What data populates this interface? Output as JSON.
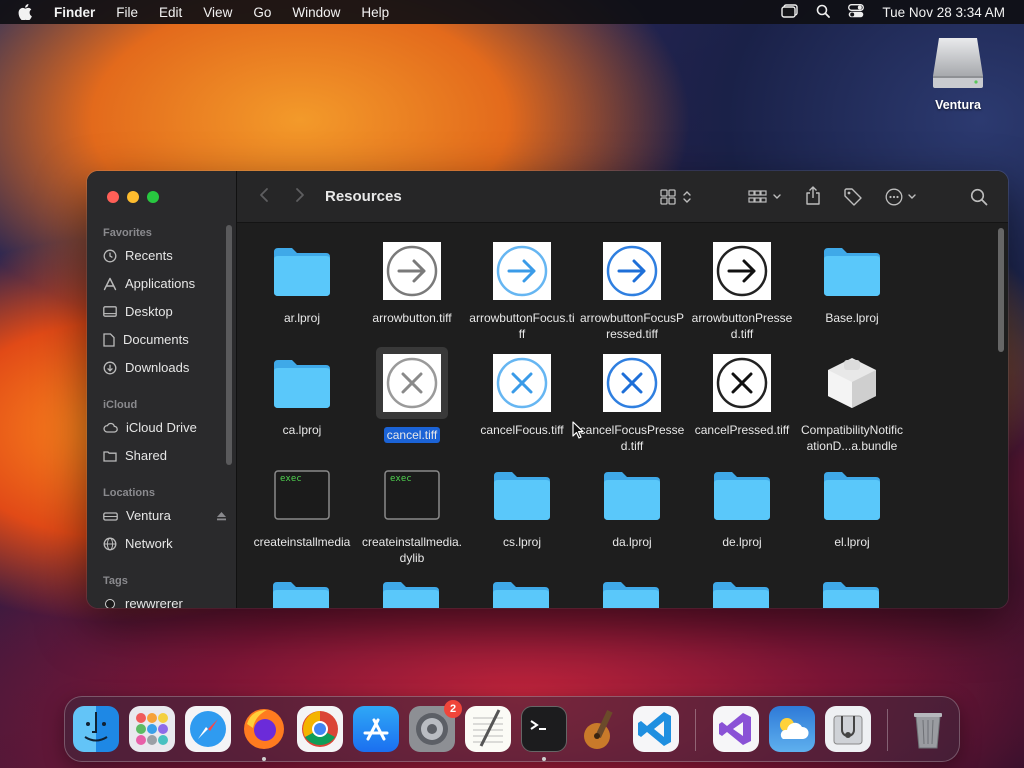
{
  "menubar": {
    "app": "Finder",
    "items": [
      "File",
      "Edit",
      "View",
      "Go",
      "Window",
      "Help"
    ],
    "clock": "Tue Nov 28  3:34 AM"
  },
  "desktop": {
    "drive_label": "Ventura"
  },
  "window": {
    "title": "Resources",
    "sidebar": {
      "favorites_header": "Favorites",
      "favorites": [
        "Recents",
        "Applications",
        "Desktop",
        "Documents",
        "Downloads"
      ],
      "icloud_header": "iCloud",
      "icloud": [
        "iCloud Drive",
        "Shared"
      ],
      "locations_header": "Locations",
      "locations": [
        "Ventura",
        "Network"
      ],
      "tags_header": "Tags",
      "tags": [
        "rewwrerer"
      ]
    },
    "files": [
      {
        "name": "ar.lproj",
        "kind": "folder"
      },
      {
        "name": "arrowbutton.tiff",
        "kind": "arrow-gray"
      },
      {
        "name": "arrowbuttonFocus.tiff",
        "kind": "arrow-blue-light"
      },
      {
        "name": "arrowbuttonFocusPressed.tiff",
        "kind": "arrow-blue"
      },
      {
        "name": "arrowbuttonPressed.tiff",
        "kind": "arrow-black"
      },
      {
        "name": "Base.lproj",
        "kind": "folder"
      },
      {
        "name": "ca.lproj",
        "kind": "folder"
      },
      {
        "name": "cancel.tiff",
        "kind": "x-gray",
        "selected": true
      },
      {
        "name": "cancelFocus.tiff",
        "kind": "x-blue-light"
      },
      {
        "name": "cancelFocusPressed.tiff",
        "kind": "x-blue"
      },
      {
        "name": "cancelPressed.tiff",
        "kind": "x-black"
      },
      {
        "name": "CompatibilityNotificationD...a.bundle",
        "kind": "bundle"
      },
      {
        "name": "createinstallmedia",
        "kind": "exec"
      },
      {
        "name": "createinstallmedia.dylib",
        "kind": "exec"
      },
      {
        "name": "cs.lproj",
        "kind": "folder"
      },
      {
        "name": "da.lproj",
        "kind": "folder"
      },
      {
        "name": "de.lproj",
        "kind": "folder"
      },
      {
        "name": "el.lproj",
        "kind": "folder"
      }
    ],
    "exec_badge": "exec"
  },
  "dock": {
    "apps": [
      "Finder",
      "Launchpad",
      "Safari",
      "Firefox",
      "Chrome",
      "App Store",
      "System Settings",
      "TextEdit",
      "Terminal",
      "Instruments",
      "Visual Studio Code",
      "Visual Studio",
      "Weather",
      "Disk Utility",
      "Trash"
    ],
    "settings_badge": "2"
  },
  "colors": {
    "folder": "#5ac8fa",
    "selection": "#1b63d6",
    "accent_blue": "#2f8ff0"
  }
}
